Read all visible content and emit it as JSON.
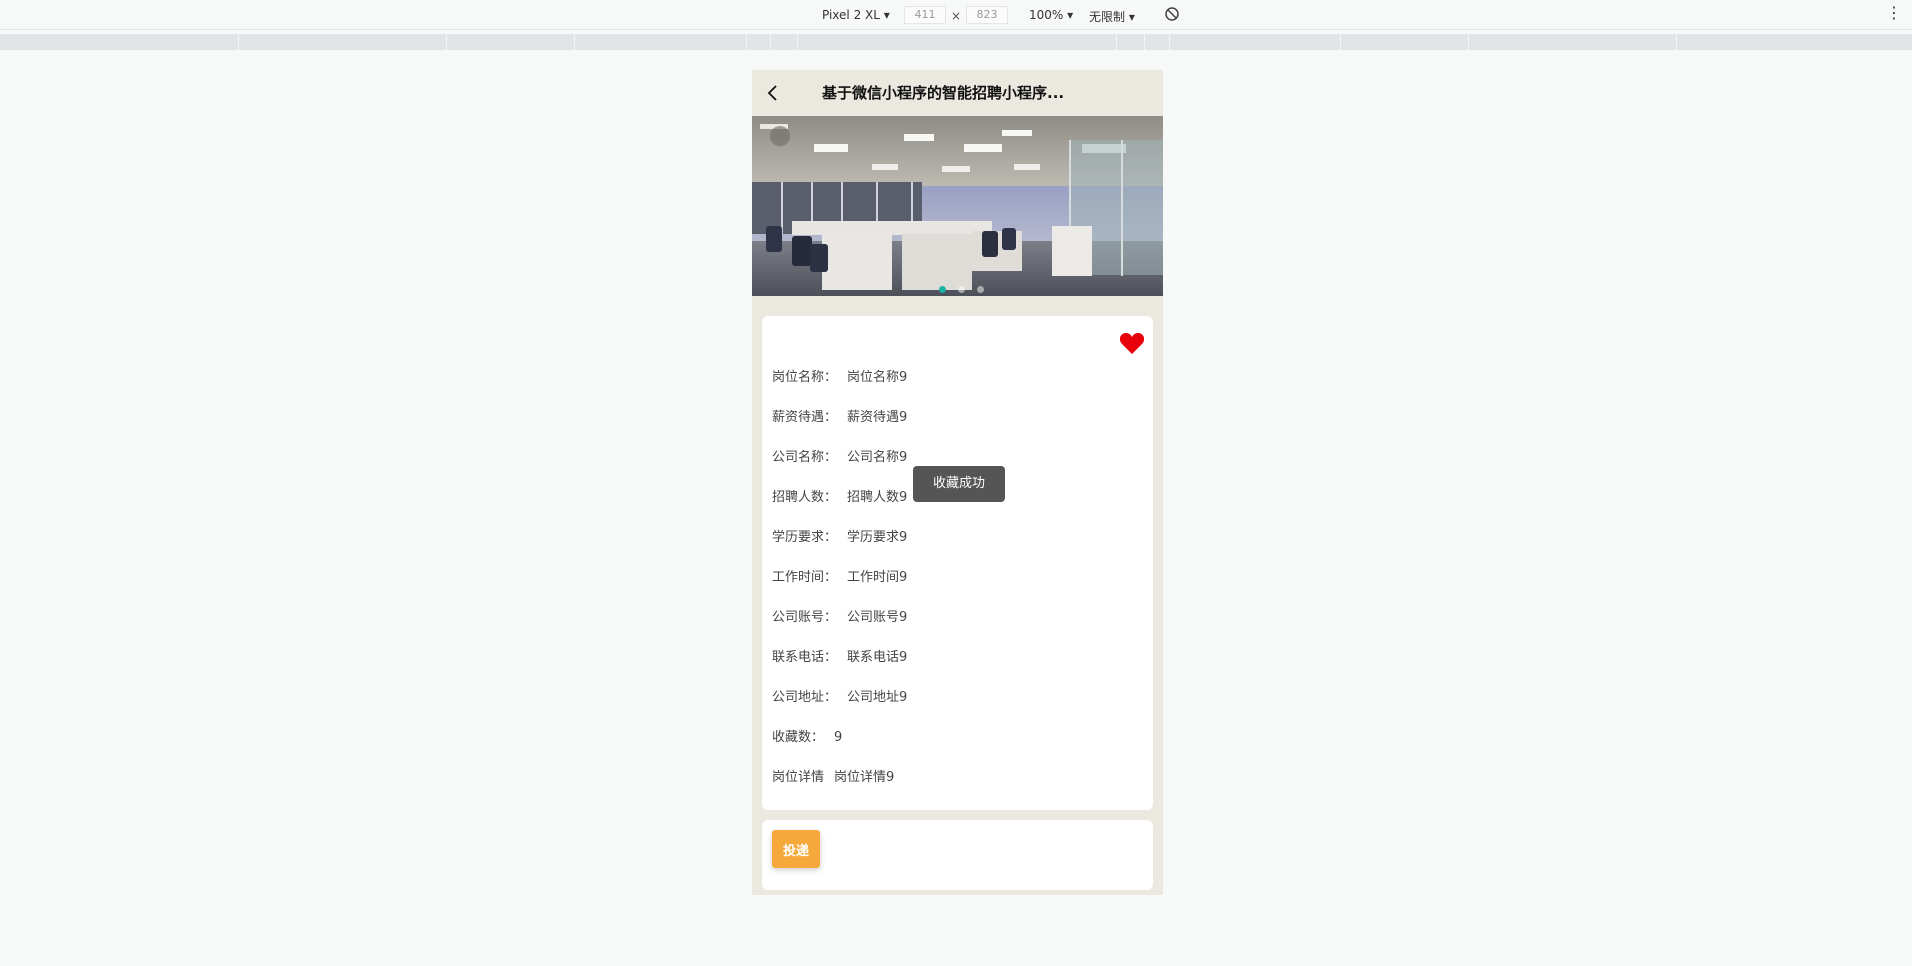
{
  "devtools": {
    "device": "Pixel 2 XL ▾",
    "width": "411",
    "times": "×",
    "height": "823",
    "zoom": "100% ▾",
    "throttle": "无限制 ▾",
    "more": "⋮"
  },
  "nav": {
    "title": "基于微信小程序的智能招聘小程序..."
  },
  "banner": {
    "slides": 3,
    "active_index": 0
  },
  "details": [
    {
      "label": "岗位名称：",
      "value": "岗位名称9"
    },
    {
      "label": "薪资待遇：",
      "value": "薪资待遇9"
    },
    {
      "label": "公司名称：",
      "value": "公司名称9"
    },
    {
      "label": "招聘人数：",
      "value": "招聘人数9"
    },
    {
      "label": "学历要求：",
      "value": "学历要求9"
    },
    {
      "label": "工作时间：",
      "value": "工作时间9"
    },
    {
      "label": "公司账号：",
      "value": "公司账号9"
    },
    {
      "label": "联系电话：",
      "value": "联系电话9"
    },
    {
      "label": "公司地址：",
      "value": "公司地址9"
    },
    {
      "label": "收藏数：",
      "value": "9"
    },
    {
      "label": "岗位详情",
      "value": "岗位详情9"
    }
  ],
  "toast": "收藏成功",
  "footer": {
    "apply_label": "投递"
  },
  "colors": {
    "heart": "#e8000b",
    "apply": "#f5a93b",
    "page_bg": "#ebe8e0"
  }
}
